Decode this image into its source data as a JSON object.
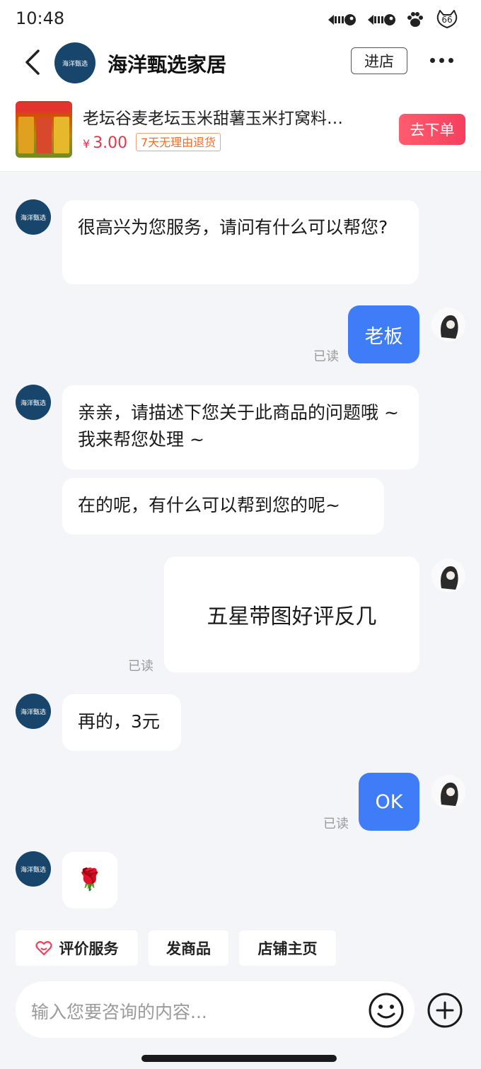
{
  "status_bar": {
    "time": "10:48",
    "badge": "66"
  },
  "header": {
    "shop_name": "海洋甄选家居",
    "avatar_text": "海洋甄选",
    "enter_label": "进店"
  },
  "product": {
    "title": "老坛谷麦老坛玉米甜薯玉米打窝料…",
    "currency": "¥",
    "price": "3.00",
    "tag": "7天无理由退货",
    "order_label": "去下单"
  },
  "messages": [
    {
      "side": "left",
      "text": "很高兴为您服务，请问有什么可以帮您?"
    },
    {
      "side": "right",
      "text": "老板",
      "status": "已读"
    },
    {
      "side": "left",
      "text": "亲亲，请描述下您关于此商品的问题哦 ~ 我来帮您处理 ~"
    },
    {
      "side": "left",
      "text": "在的呢，有什么可以帮到您的呢~"
    },
    {
      "side": "right",
      "text": "五星带图好评反几",
      "status": "已读"
    },
    {
      "side": "left",
      "text": "再的，3元"
    },
    {
      "side": "right",
      "text": "OK",
      "status": "已读"
    },
    {
      "side": "left",
      "text": "🌹"
    }
  ],
  "quick_actions": [
    "评价服务",
    "发商品",
    "店铺主页"
  ],
  "input": {
    "placeholder": "输入您要咨询的内容..."
  },
  "colors": {
    "accent_blue": "#3f7cf7",
    "price_red": "#e8334f",
    "shop_navy": "#17456b"
  },
  "icons": [
    "back-icon",
    "more-icon",
    "emoji-icon",
    "plus-icon",
    "heart-icon"
  ]
}
